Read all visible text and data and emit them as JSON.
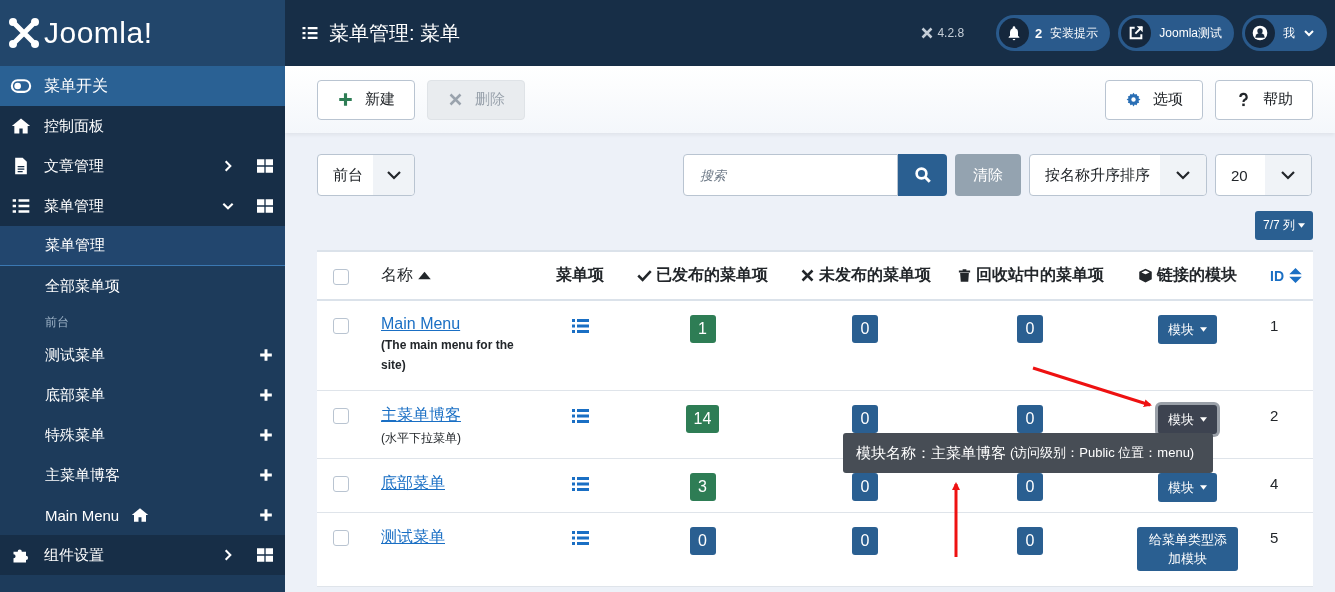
{
  "sidebar": {
    "logo": "Joomla!",
    "items": [
      {
        "kind": "toggle",
        "label": "菜单开关"
      },
      {
        "kind": "item",
        "label": "控制面板"
      },
      {
        "kind": "item",
        "label": "文章管理",
        "expanded": false
      },
      {
        "kind": "item",
        "label": "菜单管理",
        "expanded": true
      },
      {
        "kind": "sub",
        "label": "菜单管理",
        "selected": true
      },
      {
        "kind": "sub",
        "label": "全部菜单项",
        "selected": false
      },
      {
        "kind": "heading",
        "label": "前台"
      },
      {
        "kind": "sub",
        "label": "测试菜单",
        "selected": false,
        "add": true
      },
      {
        "kind": "sub",
        "label": "底部菜单",
        "selected": false,
        "add": true
      },
      {
        "kind": "sub",
        "label": "特殊菜单",
        "selected": false,
        "add": true
      },
      {
        "kind": "sub",
        "label": "主菜单博客",
        "selected": false,
        "add": true
      },
      {
        "kind": "sub",
        "label": "Main Menu",
        "selected": false,
        "add": true,
        "home": true
      },
      {
        "kind": "item",
        "label": "组件设置",
        "expanded": false
      }
    ]
  },
  "header": {
    "title": "菜单管理: 菜单",
    "version": "4.2.8",
    "notifications": {
      "count": "2",
      "label": "安装提示"
    },
    "site_link": "Joomla测试",
    "user": "我"
  },
  "toolbar": {
    "buttons": [
      {
        "kind": "new",
        "label": "新建",
        "disabled": false
      },
      {
        "kind": "delete",
        "label": "删除",
        "disabled": true
      }
    ],
    "right_buttons": [
      {
        "kind": "options",
        "label": "选项"
      },
      {
        "kind": "help",
        "label": "帮助"
      }
    ]
  },
  "filters": {
    "client": "前台",
    "search": {
      "placeholder": "搜索"
    },
    "clear": {
      "label": "清除",
      "disabled": true
    },
    "ordering": "按名称升序排序",
    "limit": "20",
    "columns_button": "7/7 列"
  },
  "table": {
    "columns": [
      {
        "kind": "check",
        "checked": false
      },
      {
        "kind": "name",
        "label": "名称"
      },
      {
        "kind": "items",
        "label": "菜单项"
      },
      {
        "kind": "published",
        "label": "已发布的菜单项"
      },
      {
        "kind": "unpublished",
        "label": "未发布的菜单项"
      },
      {
        "kind": "trashed",
        "label": "回收站中的菜单项"
      },
      {
        "kind": "modules",
        "label": "链接的模块"
      },
      {
        "kind": "id",
        "label": "ID"
      }
    ],
    "rows": [
      {
        "checked": false,
        "name": "Main Menu",
        "description": "(The main menu for the site)",
        "published": {
          "text": "1",
          "color": "#2e7d55"
        },
        "unpublished": "0",
        "trashed": "0",
        "module": {
          "kind": "dropdown",
          "label": "模块",
          "focused": false
        },
        "id": "1"
      },
      {
        "checked": false,
        "name": "主菜单博客",
        "description": "(水平下拉菜单)",
        "published": {
          "text": "14",
          "color": "#2e7d55"
        },
        "unpublished": "0",
        "trashed": "0",
        "module": {
          "kind": "dropdown",
          "label": "模块",
          "focused": true
        },
        "id": "2"
      },
      {
        "checked": false,
        "name": "底部菜单",
        "published": {
          "text": "3",
          "color": "#2e7d55"
        },
        "unpublished": "0",
        "trashed": "0",
        "module": {
          "kind": "dropdown",
          "label": "模块",
          "focused": false
        },
        "id": "4"
      },
      {
        "checked": false,
        "name": "测试菜单",
        "published": {
          "text": "0",
          "color": "#2a5f91"
        },
        "unpublished": "0",
        "trashed": "0",
        "module": {
          "kind": "add",
          "label": "给菜单类型添加模块",
          "focused": false
        },
        "id": "5"
      }
    ]
  },
  "tooltip": {
    "title": "模块名称：主菜单博客",
    "detail": "(访问级别：Public 位置：menu)"
  }
}
